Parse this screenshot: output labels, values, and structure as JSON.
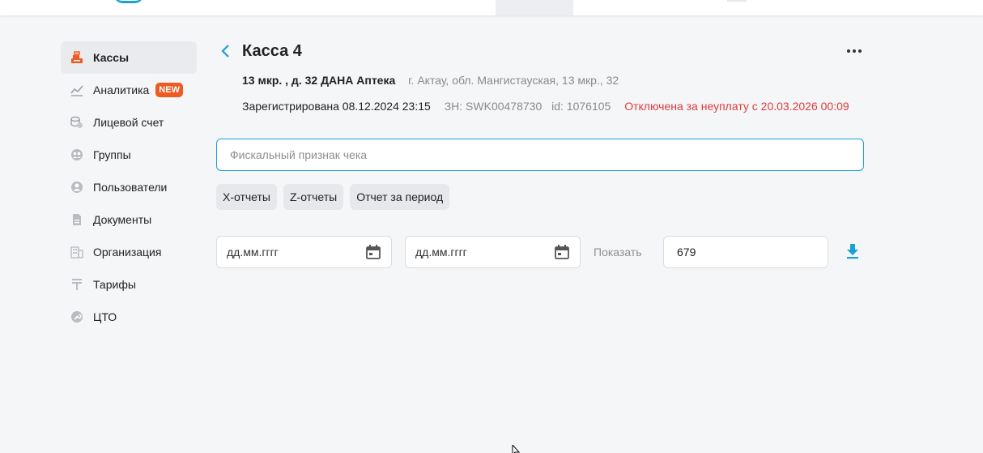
{
  "colors": {
    "accent": "#1a9fd6",
    "brand_orange": "#f05a22",
    "danger": "#e03a3a",
    "muted": "#8a8a8a",
    "background": "#f5f6f8"
  },
  "sidebar": {
    "items": [
      {
        "label": "Кассы",
        "icon": "cash-register-icon",
        "active": true
      },
      {
        "label": "Аналитика",
        "icon": "chart-icon",
        "badge": "NEW"
      },
      {
        "label": "Лицевой счет",
        "icon": "coins-icon"
      },
      {
        "label": "Группы",
        "icon": "groups-icon"
      },
      {
        "label": "Пользователи",
        "icon": "user-icon"
      },
      {
        "label": "Документы",
        "icon": "document-icon"
      },
      {
        "label": "Организация",
        "icon": "building-icon"
      },
      {
        "label": "Тарифы",
        "icon": "tenge-icon"
      },
      {
        "label": "ЦТО",
        "icon": "wrench-icon"
      }
    ]
  },
  "header": {
    "title": "Касса 4",
    "store_name": "13 мкр. , д. 32 ДАНА Аптека",
    "address": "г. Актау, обл. Мангистауская, 13 мкр., 32",
    "registered": "Зарегистрирована 08.12.2024 23:15",
    "serial": "ЗН: SWK00478730",
    "id": "id: 1076105",
    "status": "Отключена за неуплату с 20.03.2026 00:09"
  },
  "search": {
    "placeholder": "Фискальный признак чека",
    "value": ""
  },
  "reports": {
    "tabs": [
      "Х-отчеты",
      "Z-отчеты",
      "Отчет за период"
    ]
  },
  "filters": {
    "date_from_placeholder": "дд.мм.гггг",
    "date_to_placeholder": "дд.мм.гггг",
    "show_label": "Показать",
    "show_value": "679"
  }
}
